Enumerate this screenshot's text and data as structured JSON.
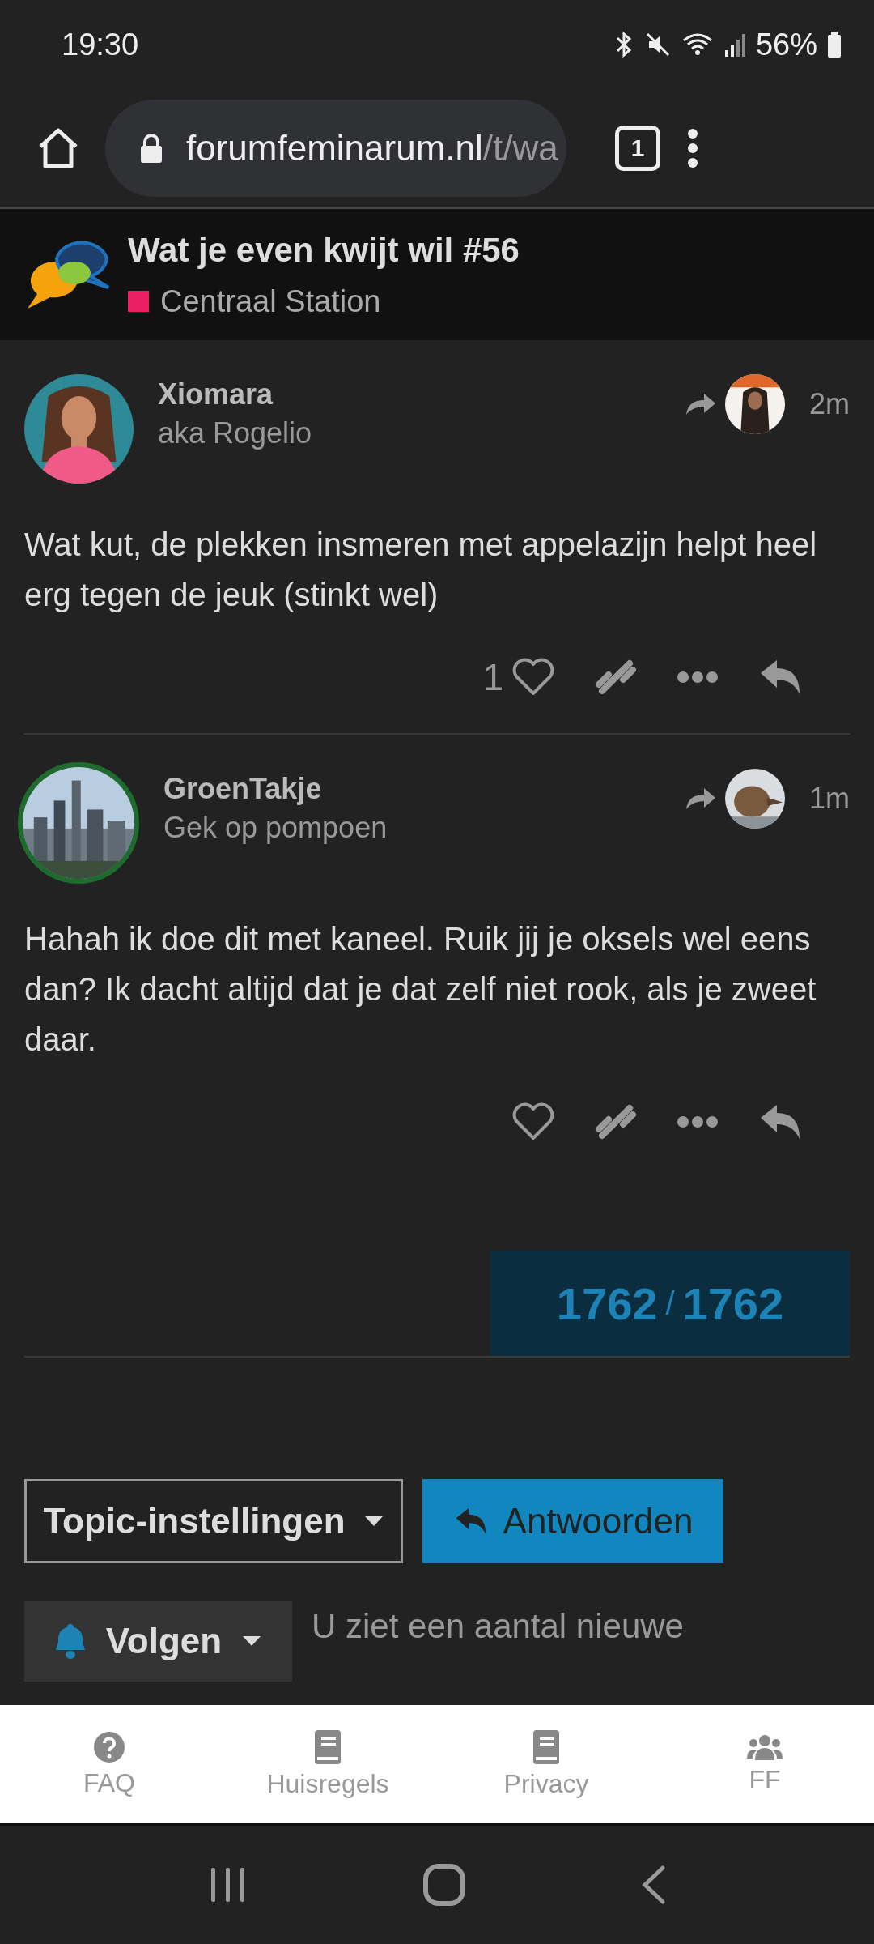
{
  "status_bar": {
    "time": "19:30",
    "battery": "56%"
  },
  "browser": {
    "url_host": "forumfeminarum.nl",
    "url_path": "/t/wa",
    "tab_count": "1"
  },
  "topic": {
    "title": "Wat je even kwijt wil #56",
    "category": {
      "name": "Centraal Station",
      "color": "#e91e63"
    }
  },
  "posts": [
    {
      "username": "Xiomara",
      "user_title": "aka Rogelio",
      "time": "2m",
      "body": "Wat kut, de plekken insmeren met appelazijn helpt heel erg tegen de jeuk (stinkt wel)",
      "like_count": "1",
      "avatar_ring": false
    },
    {
      "username": "GroenTakje",
      "user_title": "Gek op pompoen",
      "time": "1m",
      "body": "Hahah ik doe dit met kaneel. Ruik jij je oksels wel eens dan? Ik dacht altijd dat je dat zelf niet rook, als je zweet daar.",
      "avatar_ring": true
    }
  ],
  "progress": {
    "current": "1762",
    "separator": "/",
    "total": "1762"
  },
  "controls": {
    "settings_button": "Topic-instellingen",
    "reply_button": "Antwoorden",
    "notification_button": "Volgen",
    "notification_text": "U ziet een aantal nieuwe"
  },
  "footer_nav": [
    {
      "label": "FAQ",
      "kind": "question"
    },
    {
      "label": "Huisregels",
      "kind": "book"
    },
    {
      "label": "Privacy",
      "kind": "book"
    },
    {
      "label": "FF",
      "kind": "users"
    }
  ]
}
